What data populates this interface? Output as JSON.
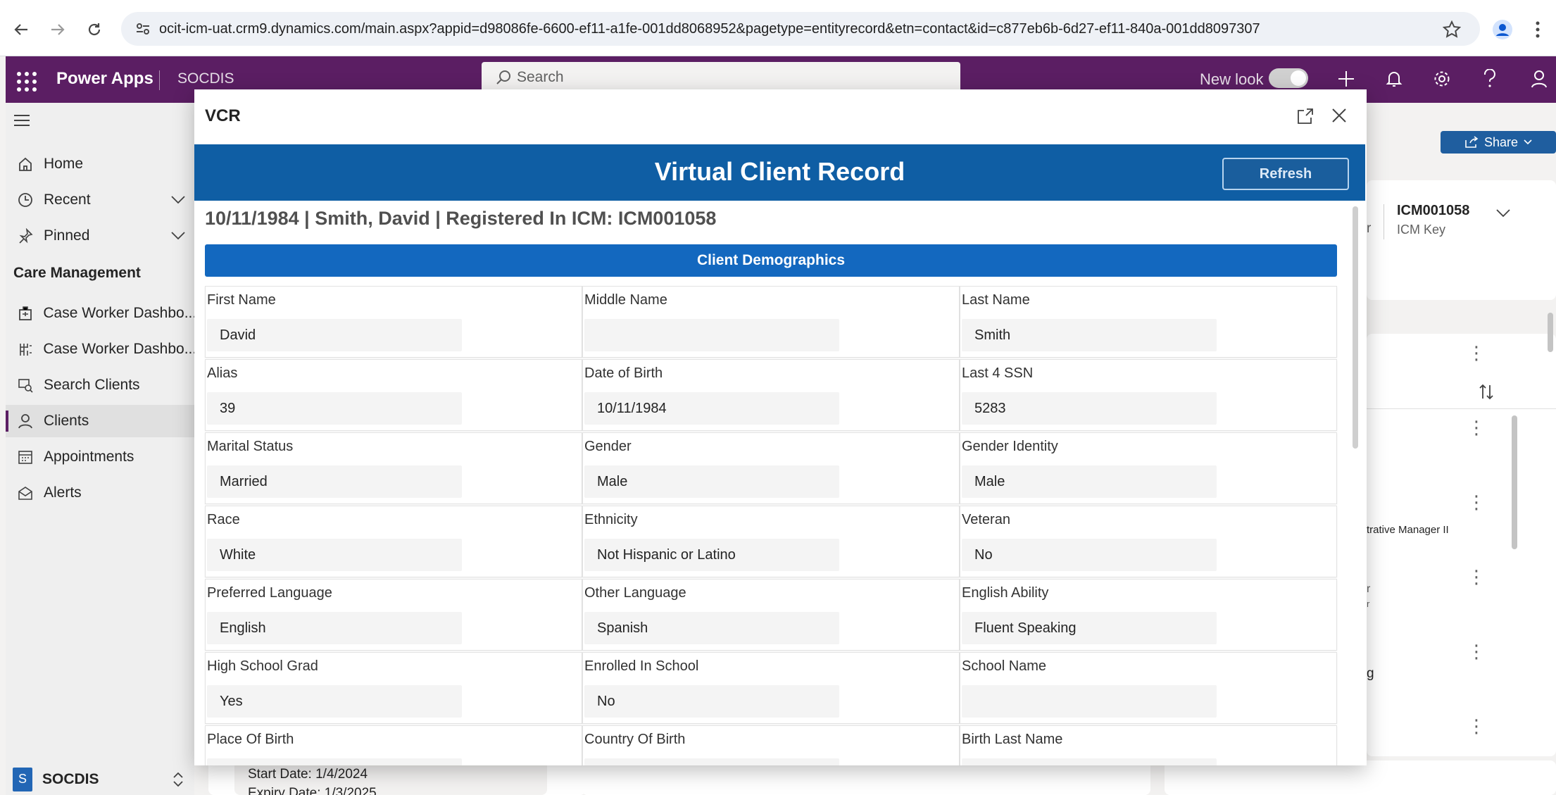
{
  "browser": {
    "url": "ocit-icm-uat.crm9.dynamics.com/main.aspx?appid=d98086fe-6600-ef11-a1fe-001dd8068952&pagetype=entityrecord&etn=contact&id=c877eb6b-6d27-ef11-840a-001dd8097307"
  },
  "header": {
    "app_name": "Power Apps",
    "env_name": "SOCDIS",
    "search_placeholder": "Search",
    "new_look_label": "New look"
  },
  "sidebar": {
    "items": [
      {
        "label": "Home",
        "icon": "home-icon"
      },
      {
        "label": "Recent",
        "icon": "clock-icon"
      },
      {
        "label": "Pinned",
        "icon": "pin-icon"
      }
    ],
    "section_title": "Care Management",
    "section_items": [
      {
        "label": "Case Worker Dashbo...",
        "icon": "dashboard-icon"
      },
      {
        "label": "Case Worker Dashbo...",
        "icon": "dashboard-grid-icon"
      },
      {
        "label": "Search Clients",
        "icon": "search-clients-icon"
      },
      {
        "label": "Clients",
        "icon": "person-icon"
      },
      {
        "label": "Appointments",
        "icon": "calendar-icon"
      },
      {
        "label": "Alerts",
        "icon": "mail-alert-icon"
      }
    ],
    "footer_badge": "S",
    "footer_label": "SOCDIS"
  },
  "background": {
    "share_label": "Share",
    "icm_value": "ICM001058",
    "icm_label": "ICM Key",
    "partial_r": "r",
    "role_fragment": "trative Manager II",
    "fragment_r1": "r",
    "fragment_r2": "r",
    "fragment_g": "g",
    "start_date": "Start Date: 1/4/2024",
    "expiry_date": "Expiry Date: 1/3/2025"
  },
  "modal": {
    "title": "VCR",
    "banner_title": "Virtual Client Record",
    "refresh_label": "Refresh",
    "record_line": "10/11/1984 | Smith, David | Registered In ICM: ICM001058",
    "section_title": "Client Demographics",
    "fields": [
      [
        {
          "label": "First Name",
          "value": "David"
        },
        {
          "label": "Middle Name",
          "value": ""
        },
        {
          "label": "Last Name",
          "value": "Smith"
        }
      ],
      [
        {
          "label": "Alias",
          "value": "39"
        },
        {
          "label": "Date of Birth",
          "value": "10/11/1984"
        },
        {
          "label": "Last 4 SSN",
          "value": "5283"
        }
      ],
      [
        {
          "label": "Marital Status",
          "value": "Married"
        },
        {
          "label": "Gender",
          "value": "Male"
        },
        {
          "label": "Gender Identity",
          "value": "Male"
        }
      ],
      [
        {
          "label": "Race",
          "value": "White"
        },
        {
          "label": "Ethnicity",
          "value": "Not Hispanic or Latino"
        },
        {
          "label": "Veteran",
          "value": "No"
        }
      ],
      [
        {
          "label": "Preferred Language",
          "value": "English"
        },
        {
          "label": "Other Language",
          "value": "Spanish"
        },
        {
          "label": "English Ability",
          "value": "Fluent Speaking"
        }
      ],
      [
        {
          "label": "High School Grad",
          "value": "Yes"
        },
        {
          "label": "Enrolled In School",
          "value": "No"
        },
        {
          "label": "School Name",
          "value": ""
        }
      ],
      [
        {
          "label": "Place Of Birth",
          "value": ""
        },
        {
          "label": "Country Of Birth",
          "value": ""
        },
        {
          "label": "Birth Last Name",
          "value": ""
        }
      ]
    ]
  }
}
